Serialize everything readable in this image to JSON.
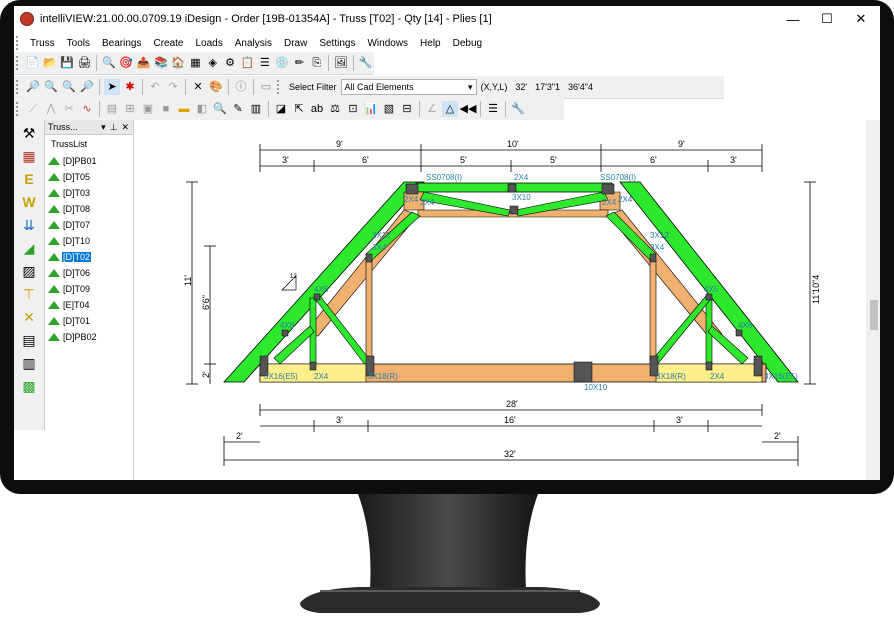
{
  "window": {
    "title": "intelliVIEW:21.00.00.0709.19 iDesign - Order [19B-01354A] - Truss [T02] - Qty [14] - Plies [1]",
    "minimize": "—",
    "maximize": "☐",
    "close": "✕"
  },
  "menu": [
    "Truss",
    "Tools",
    "Bearings",
    "Create",
    "Loads",
    "Analysis",
    "Draw",
    "Settings",
    "Windows",
    "Help",
    "Debug"
  ],
  "filter": {
    "label": "Select Filter",
    "value": "All Cad Elements"
  },
  "coords": {
    "label": "(X,Y,L)",
    "x": "32'",
    "y": "17'3\"1",
    "l": "36'4\"4"
  },
  "panel": {
    "title": "Truss...",
    "pin": "📌",
    "close": "✕",
    "root": "TrussList"
  },
  "trusses": [
    {
      "label": "[D]PB01"
    },
    {
      "label": "[D]T05"
    },
    {
      "label": "[D]T03"
    },
    {
      "label": "[D]T08"
    },
    {
      "label": "[D]T07"
    },
    {
      "label": "[D]T10"
    },
    {
      "label": "[D]T02",
      "selected": true
    },
    {
      "label": "[D]T06"
    },
    {
      "label": "[D]T09"
    },
    {
      "label": "[E]T04"
    },
    {
      "label": "[D]T01"
    },
    {
      "label": "[D]PB02"
    }
  ],
  "drawing": {
    "top_dims": [
      "9'",
      "10'",
      "9'"
    ],
    "top_sub_dims": [
      "3'",
      "6'",
      "5'",
      "5'",
      "6'",
      "3'"
    ],
    "left_height": "11'",
    "left_inner": "6'6\"",
    "left_small": "2'",
    "right_height": "11'10\"4",
    "bottom_span": "28'",
    "bottom_sub_dims": [
      "3'",
      "16'",
      "3'"
    ],
    "overhang_left": "2'",
    "overhang_right": "2'",
    "total_span": "32'",
    "plates": {
      "ss_left": "SS0708(I)",
      "ss_right": "SS0708(I)",
      "top_center": "2X4",
      "web_center": "3X10",
      "p2x4_l1": "2X4",
      "p2x4_l2": "2X4",
      "p2x4_r1": "2X4",
      "p2x4_r2": "2X4",
      "p3x12_l": "3X12",
      "p3x4_l": "3X4",
      "p3x12_r": "3X12",
      "p3x4_r": "3X4",
      "p4x5_l": "4X5",
      "p4x5_r": "4X5",
      "p4x6_l": "4X6",
      "p4x6_r": "4X6",
      "heel_l": "3X16(E5)",
      "bot_l_2x4": "2X4",
      "bot_l_3x18": "3X18(R)",
      "bot_center": "10X10",
      "bot_r_3x18": "3X18(R)",
      "bot_r_2x4": "2X4",
      "heel_r": "3X16(E5)",
      "pitch": "12"
    }
  }
}
